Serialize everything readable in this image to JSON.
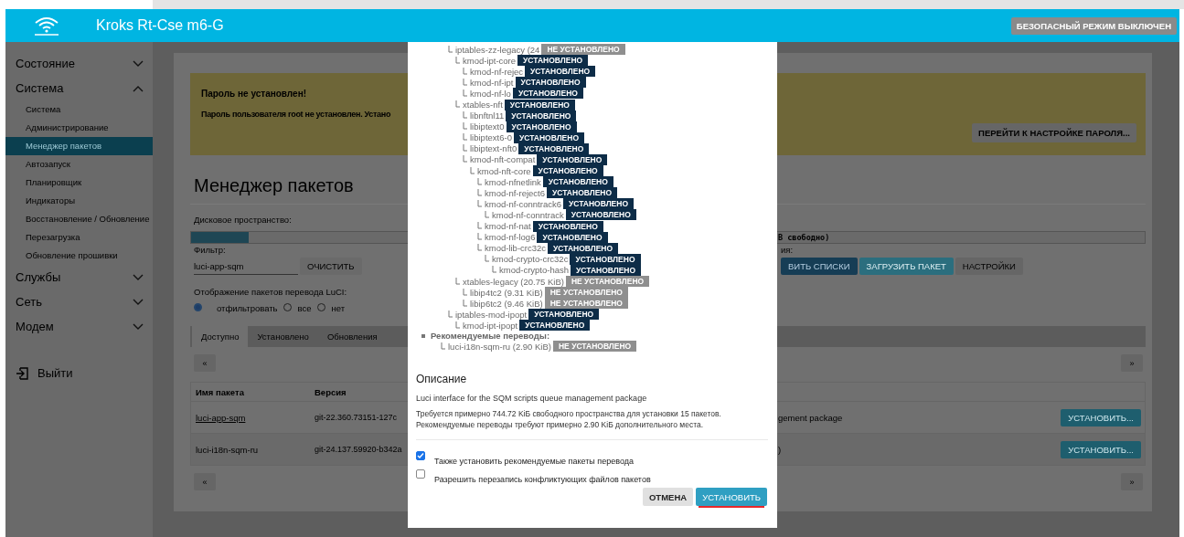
{
  "header": {
    "title": "Kroks Rt-Cse m6-G",
    "safe_mode": "БЕЗОПАСНЫЙ РЕЖИМ ВЫКЛЮЧЕН"
  },
  "sidebar": {
    "items": [
      {
        "label": "Состояние",
        "expanded": false
      },
      {
        "label": "Система",
        "expanded": true,
        "children": [
          {
            "label": "Система",
            "selected": false
          },
          {
            "label": "Администрирование",
            "selected": false
          },
          {
            "label": "Менеджер пакетов",
            "selected": true
          },
          {
            "label": "Автозапуск",
            "selected": false
          },
          {
            "label": "Планировщик",
            "selected": false
          },
          {
            "label": "Индикаторы",
            "selected": false
          },
          {
            "label": "Восстановление / Обновление",
            "selected": false
          },
          {
            "label": "Перезагрузка",
            "selected": false
          },
          {
            "label": "Обновление прошивки",
            "selected": false
          }
        ]
      },
      {
        "label": "Службы",
        "expanded": false
      },
      {
        "label": "Сеть",
        "expanded": false
      },
      {
        "label": "Модем",
        "expanded": false
      }
    ],
    "logout": "Выйти"
  },
  "warning": {
    "title": "Пароль не установлен!",
    "text": "Пароль пользователя root не установлен. Устано",
    "button": "ПЕРЕЙТИ К НАСТРОЙКЕ ПАРОЛЯ..."
  },
  "page_title": "Менеджер пакетов",
  "disk": {
    "label": "Дисковое пространство:",
    "level": 0.06,
    "reading": "B свободно)"
  },
  "filter": {
    "label": "Фильтр:",
    "value": "luci-app-sqm",
    "clear_button": "ОЧИСТИТЬ"
  },
  "actions": {
    "label": "ия:",
    "buttons": [
      {
        "label": "ВИТЬ СПИСКИ",
        "kind": "primary"
      },
      {
        "label": "ЗАГРУЗИТЬ ПАКЕТ",
        "kind": "info"
      },
      {
        "label": "НАСТРОЙКИ",
        "kind": "neutral"
      }
    ]
  },
  "translations": {
    "label": "Отображение пакетов перевода LuCI:",
    "options": [
      {
        "label": "отфильтровать",
        "selected": true
      },
      {
        "label": "все",
        "selected": false
      },
      {
        "label": "нет",
        "selected": false
      }
    ]
  },
  "tabs": [
    {
      "label": "Доступно",
      "selected": true
    },
    {
      "label": "Установлено",
      "selected": false
    },
    {
      "label": "Обновления",
      "selected": false
    }
  ],
  "pager_top": {
    "prev": "«",
    "next": "»"
  },
  "table": {
    "columns": [
      "Имя пакета",
      "Версия"
    ],
    "rows": [
      {
        "name": "luci-app-sqm",
        "link": true,
        "version": "git-22.360.73151-127c",
        "description": "gement package",
        "button": "УСТАНОВИТЬ..."
      },
      {
        "name": "luci-i18n-sqm-ru",
        "link": false,
        "version": "git-24.137.59920-b342a",
        "description": ")",
        "button": "УСТАНОВИТЬ..."
      }
    ]
  },
  "pager_bottom": {
    "prev": "«",
    "next": "»"
  },
  "dialog": {
    "tree": [
      {
        "name": "iptables-zz-legacy (24",
        "status": "НЕ УСТАНОВЛЕНО",
        "installed": false,
        "children": [
          {
            "name": "kmod-ipt-core",
            "status": "УСТАНОВЛЕНО",
            "installed": true,
            "children": [
              {
                "name": "kmod-nf-rejec",
                "status": "УСТАНОВЛЕНО",
                "installed": true
              },
              {
                "name": "kmod-nf-ipt",
                "status": "УСТАНОВЛЕНО",
                "installed": true
              },
              {
                "name": "kmod-nf-lo",
                "status": "УСТАНОВЛЕНО",
                "installed": true
              }
            ]
          },
          {
            "name": "xtables-nft",
            "status": "УСТАНОВЛЕНО",
            "installed": true,
            "children": [
              {
                "name": "libnftnl11",
                "status": "УСТАНОВЛЕНО",
                "installed": true
              },
              {
                "name": "libiptext0",
                "status": "УСТАНОВЛЕНО",
                "installed": true
              },
              {
                "name": "libiptext6-0",
                "status": "УСТАНОВЛЕНО",
                "installed": true
              },
              {
                "name": "libiptext-nft0",
                "status": "УСТАНОВЛЕНО",
                "installed": true
              },
              {
                "name": "kmod-nft-compat",
                "status": "УСТАНОВЛЕНО",
                "installed": true,
                "children": [
                  {
                    "name": "kmod-nft-core",
                    "status": "УСТАНОВЛЕНО",
                    "installed": true,
                    "children": [
                      {
                        "name": "kmod-nfnetlink",
                        "status": "УСТАНОВЛЕНО",
                        "installed": true
                      },
                      {
                        "name": "kmod-nf-reject6",
                        "status": "УСТАНОВЛЕНО",
                        "installed": true
                      },
                      {
                        "name": "kmod-nf-conntrack6",
                        "status": "УСТАНОВЛЕНО",
                        "installed": true,
                        "children": [
                          {
                            "name": "kmod-nf-conntrack",
                            "status": "УСТАНОВЛЕНО",
                            "installed": true
                          }
                        ]
                      },
                      {
                        "name": "kmod-nf-nat",
                        "status": "УСТАНОВЛЕНО",
                        "installed": true
                      },
                      {
                        "name": "kmod-nf-log6",
                        "status": "УСТАНОВЛЕНО",
                        "installed": true
                      },
                      {
                        "name": "kmod-lib-crc32c",
                        "status": "УСТАНОВЛЕНО",
                        "installed": true,
                        "children": [
                          {
                            "name": "kmod-crypto-crc32c",
                            "status": "УСТАНОВЛЕНО",
                            "installed": true,
                            "children": [
                              {
                                "name": "kmod-crypto-hash",
                                "status": "УСТАНОВЛЕНО",
                                "installed": true
                              }
                            ]
                          }
                        ]
                      }
                    ]
                  }
                ]
              }
            ]
          },
          {
            "name": "xtables-legacy (20.75 KiB)",
            "status": "НЕ УСТАНОВЛЕНО",
            "installed": false,
            "children": [
              {
                "name": "libip4tc2 (9.31 KiB)",
                "status": "НЕ УСТАНОВЛЕНО",
                "installed": false
              },
              {
                "name": "libip6tc2 (9.46 KiB)",
                "status": "НЕ УСТАНОВЛЕНО",
                "installed": false
              }
            ]
          }
        ]
      },
      {
        "name": "iptables-mod-ipopt",
        "status": "УСТАНОВЛЕНО",
        "installed": true,
        "children": [
          {
            "name": "kmod-ipt-ipopt",
            "status": "УСТАНОВЛЕНО",
            "installed": true
          }
        ]
      }
    ],
    "recommended": {
      "label": "Рекомендуемые переводы:",
      "items": [
        {
          "name": "luci-i18n-sqm-ru (2.90 KiB)",
          "status": "НЕ УСТАНОВЛЕНО",
          "installed": false
        }
      ]
    },
    "description_title": "Описание",
    "description": "Luci interface for the SQM scripts queue management package",
    "notes": [
      "Требуется примерно 744.72 KiБ свободного пространства для установки 15 пакетов.",
      "Рекомендуемые переводы требуют примерно 2.90 KiБ дополнительного места."
    ],
    "options": [
      {
        "label": "Также установить рекомендуемые пакеты перевода",
        "checked": true
      },
      {
        "label": "Разрешить перезапись конфликтующих файлов пакетов",
        "checked": false
      }
    ],
    "buttons": [
      {
        "label": "ОТМЕНА",
        "kind": "neutral",
        "focused": false
      },
      {
        "label": "УСТАНОВИТЬ",
        "kind": "primary",
        "focused": true
      }
    ]
  }
}
